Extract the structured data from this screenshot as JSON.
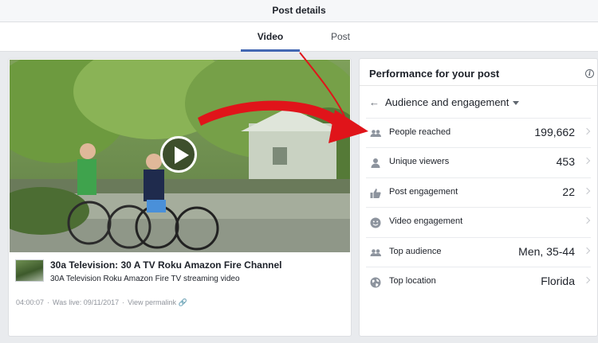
{
  "header": {
    "title": "Post details"
  },
  "tabs": [
    {
      "label": "Video",
      "active": true
    },
    {
      "label": "Post",
      "active": false
    }
  ],
  "video": {
    "title": "30a Television: 30 A TV Roku Amazon Fire Channel",
    "description": "30A Television Roku Amazon Fire TV streaming video",
    "duration": "04:00:07",
    "separator": "·",
    "was_live": "Was live: 09/11/2017",
    "permalink": "View permalink",
    "link_icon": "🔗"
  },
  "panel": {
    "title": "Performance for your post",
    "info_icon": "i",
    "back_icon": "←",
    "dropdown_label": "Audience and engagement",
    "rows": [
      {
        "icon": "people-icon",
        "label": "People reached",
        "value": "199,662"
      },
      {
        "icon": "person-icon",
        "label": "Unique viewers",
        "value": "453"
      },
      {
        "icon": "thumbs-up-icon",
        "label": "Post engagement",
        "value": "22"
      },
      {
        "icon": "smiley-icon",
        "label": "Video engagement",
        "value": ""
      },
      {
        "icon": "people-icon",
        "label": "Top audience",
        "value": "Men, 35-44"
      },
      {
        "icon": "globe-icon",
        "label": "Top location",
        "value": "Florida"
      }
    ]
  },
  "colors": {
    "accent": "#4267b2",
    "annotation_arrow": "#e0141a",
    "icon": "#8d949e"
  }
}
